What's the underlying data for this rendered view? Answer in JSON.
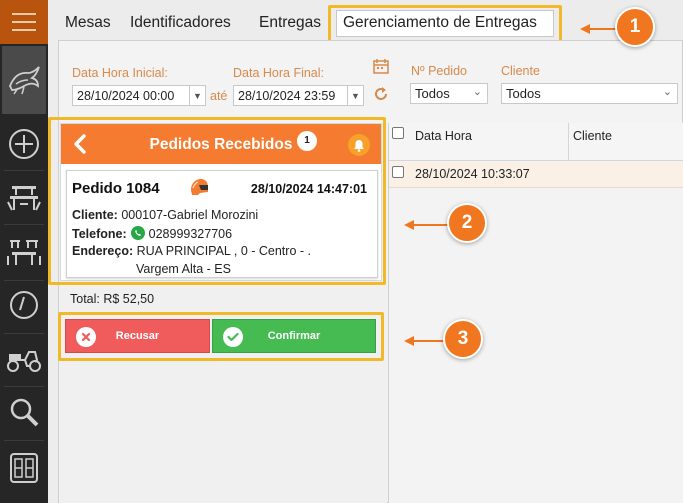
{
  "tabs": [
    {
      "label": "Mesas"
    },
    {
      "label": "Identificadores"
    },
    {
      "label": "Entregas"
    },
    {
      "label": "Gerenciamento de Entregas"
    }
  ],
  "filters": {
    "start_label": "Data Hora Inicial:",
    "start_value": "28/10/2024 00:00",
    "ate_label": "até",
    "end_label": "Data Hora Final:",
    "end_value": "28/10/2024 23:59",
    "order_label": "Nº Pedido",
    "order_value": "Todos",
    "client_label": "Cliente",
    "client_value": "Todos"
  },
  "table": {
    "columns": [
      "Data Hora",
      "Cliente"
    ],
    "rows": [
      {
        "datetime": "28/10/2024 10:33:07",
        "client": ""
      }
    ]
  },
  "popup": {
    "title": "Pedidos Recebidos",
    "badge": "1",
    "order": {
      "title": "Pedido 1084",
      "datetime": "28/10/2024 14:47:01",
      "client_label": "Cliente:",
      "client": "000107-Gabriel Morozini",
      "phone_label": "Telefone:",
      "phone": "028999327706",
      "address_label": "Endereço:",
      "address_line1": "RUA PRINCIPAL , 0 - Centro  - .",
      "address_line2": "Vargem Alta - ES"
    }
  },
  "total": "Total:  R$ 52,50",
  "buttons": {
    "refuse": "Recusar",
    "confirm": "Confirmar"
  },
  "callouts": [
    "1",
    "2",
    "3"
  ],
  "colors": {
    "accent": "#f47b30",
    "highlight": "#f1b927",
    "refuse": "#f05b5b",
    "confirm": "#46bb52",
    "sidebar": "#262626"
  }
}
